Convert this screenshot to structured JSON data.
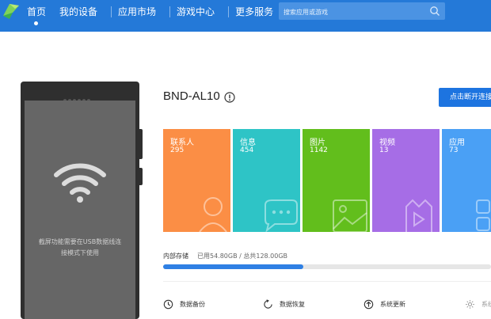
{
  "nav": {
    "items": [
      {
        "label": "首页",
        "active": true
      },
      {
        "label": "我的设备"
      },
      {
        "label": "应用市场"
      },
      {
        "label": "游戏中心"
      },
      {
        "label": "更多服务"
      }
    ],
    "search_placeholder": "搜索应用或游戏"
  },
  "phone": {
    "screen_text_line1": "截屏功能需要在USB数据线连",
    "screen_text_line2": "接模式下使用"
  },
  "device": {
    "name": "BND-AL10",
    "disconnect_label": "点击断开连接"
  },
  "tiles": [
    {
      "label": "联系人",
      "count": "295",
      "color": "#fb8e45",
      "icon": "contact-icon"
    },
    {
      "label": "信息",
      "count": "454",
      "color": "#2ec4c6",
      "icon": "message-icon"
    },
    {
      "label": "图片",
      "count": "1142",
      "color": "#62be1c",
      "icon": "picture-icon"
    },
    {
      "label": "视频",
      "count": "13",
      "color": "#a66de6",
      "icon": "video-icon"
    },
    {
      "label": "应用",
      "count": "73",
      "color": "#4aa0f5",
      "icon": "app-icon"
    }
  ],
  "storage": {
    "label": "内部存储",
    "value": "已用54.80GB / 总共128.00GB",
    "used_fraction": 0.428
  },
  "actions": [
    {
      "label": "数据备份",
      "icon": "backup-icon"
    },
    {
      "label": "数据恢复",
      "icon": "restore-icon"
    },
    {
      "label": "系统更新",
      "icon": "update-icon"
    },
    {
      "label": "系统",
      "icon": "settings-icon"
    }
  ],
  "colors": {
    "topbar": "#2479d8",
    "accent": "#1d74e0"
  }
}
